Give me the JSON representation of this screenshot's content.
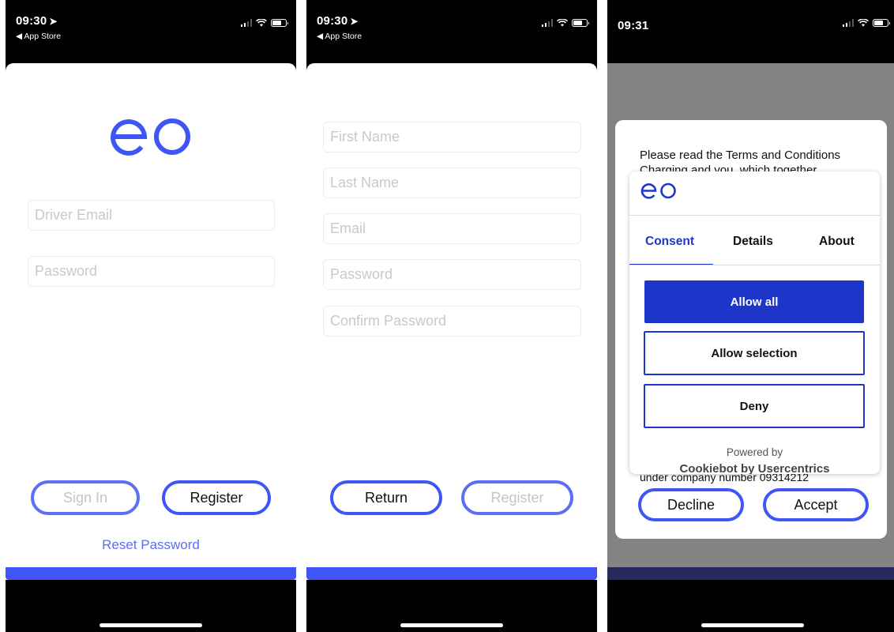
{
  "status": {
    "time_1": "09:30",
    "time_2": "09:30",
    "time_3": "09:31",
    "back_app": "◀ App Store"
  },
  "brand": {
    "logo_text": "eo",
    "color": "#3d56f5"
  },
  "signin": {
    "email_placeholder": "Driver Email",
    "password_placeholder": "Password",
    "signin_label": "Sign In",
    "register_label": "Register",
    "reset_label": "Reset Password"
  },
  "register": {
    "first_name": "First Name",
    "last_name": "Last Name",
    "email": "Email",
    "password": "Password",
    "confirm_password": "Confirm Password",
    "return_label": "Return",
    "register_label": "Register"
  },
  "terms": {
    "text_line1": "Please read the Terms and Conditions",
    "text_line2": "Charging and you, which together",
    "under_text": "under company number 09314212",
    "decline_label": "Decline",
    "accept_label": "Accept"
  },
  "cookie": {
    "tabs": [
      "Consent",
      "Details",
      "About"
    ],
    "allow_all": "Allow all",
    "allow_selection": "Allow selection",
    "deny": "Deny",
    "powered": "Powered by",
    "powered_by": "Cookiebot by Usercentrics",
    "accent": "#1d36c9"
  }
}
